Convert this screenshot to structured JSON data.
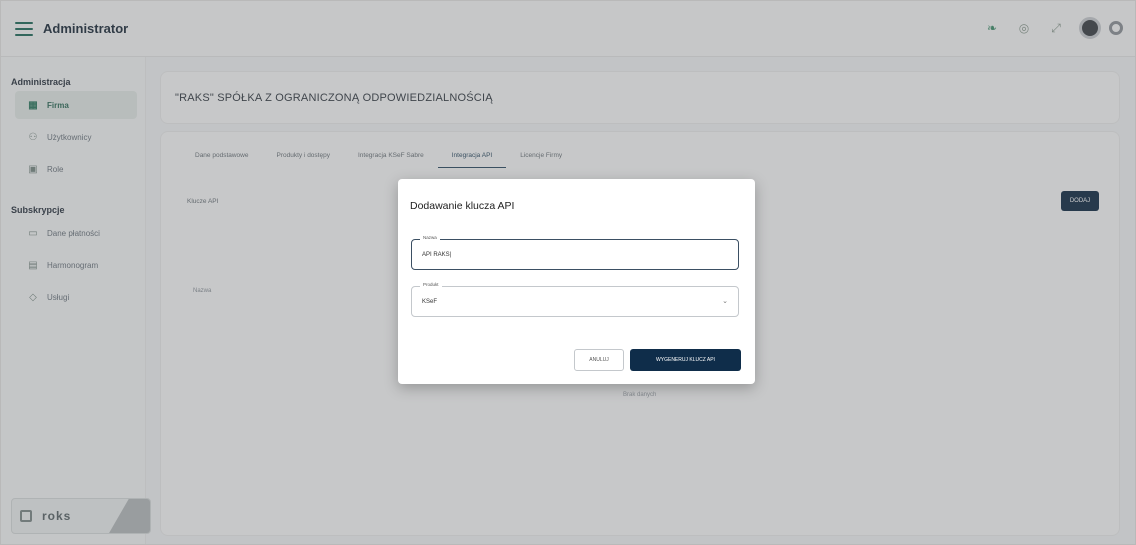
{
  "app": {
    "title": "Administrator"
  },
  "topbar": {
    "icons": [
      "leaf-icon",
      "settings-icon",
      "expand-icon",
      "avatar",
      "gear-icon"
    ]
  },
  "sidebar": {
    "section_admin": "Administracja",
    "admin_items": [
      {
        "label": "Firma",
        "icon": "building-icon",
        "active": true
      },
      {
        "label": "Użytkownicy",
        "icon": "users-icon",
        "active": false
      },
      {
        "label": "Role",
        "icon": "key-icon",
        "active": false
      }
    ],
    "section_sub": "Subskrypcje",
    "sub_items": [
      {
        "label": "Dane płatności",
        "icon": "card-icon",
        "active": false
      },
      {
        "label": "Harmonogram",
        "icon": "calendar-icon",
        "active": false
      },
      {
        "label": "Usługi",
        "icon": "box-icon",
        "active": false
      }
    ],
    "logo": "roks"
  },
  "header": {
    "company_name": "\"RAKS\" SPÓŁKA Z OGRANICZONĄ ODPOWIEDZIALNOŚCIĄ"
  },
  "tabs": [
    {
      "label": "Dane podstawowe",
      "active": false
    },
    {
      "label": "Produkty i dostępy",
      "active": false
    },
    {
      "label": "Integracja KSeF Sabre",
      "active": false
    },
    {
      "label": "Integracja API",
      "active": true
    },
    {
      "label": "Licencje Firmy",
      "active": false
    }
  ],
  "content": {
    "section_label": "Klucze API",
    "add_button": "DODAJ",
    "column_name": "Nazwa",
    "empty_message": "Brak danych"
  },
  "modal": {
    "title": "Dodawanie klucza API",
    "name_label": "Nazwa",
    "name_value": "API RAKS|",
    "product_label": "Produkt",
    "product_value": "KSeF",
    "cancel_button": "ANULUJ",
    "generate_button": "WYGENERUJ KLUCZ API"
  },
  "colors": {
    "accent": "#0f2d4a",
    "active_item": "#2d6b58"
  }
}
